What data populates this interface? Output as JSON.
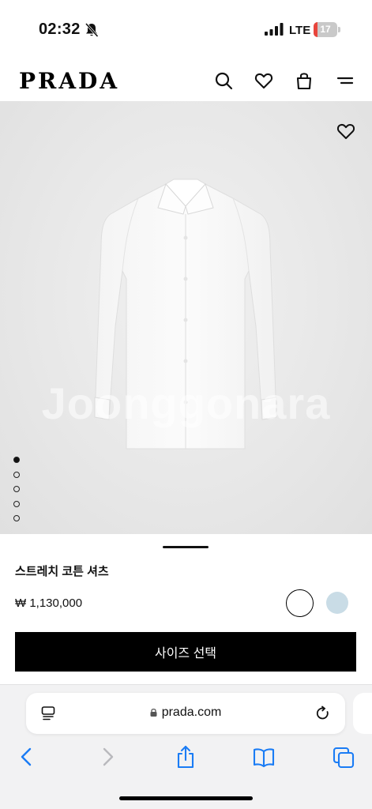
{
  "status_bar": {
    "time": "02:32",
    "network": "LTE",
    "battery_level": "17",
    "battery_fraction": 0.17,
    "icons": [
      "bell-off-icon",
      "signal-icon",
      "battery-icon"
    ]
  },
  "header": {
    "logo": "PRADA",
    "icons": [
      "search-icon",
      "heart-icon",
      "shopping-bag-icon",
      "menu-icon"
    ]
  },
  "product": {
    "watermark": "Joonggonara",
    "image_count": 5,
    "active_image": 1,
    "name": "스트레치 코튼 셔츠",
    "price": "₩ 1,130,000",
    "colors": [
      {
        "name": "white",
        "hex": "#ffffff",
        "selected": true
      },
      {
        "name": "light-blue",
        "hex": "#c9dce6",
        "selected": false
      }
    ],
    "size_button_label": "사이즈 선택"
  },
  "browser": {
    "url": "prada.com",
    "icons": [
      "reader-icon",
      "lock-icon",
      "reload-icon",
      "back-icon",
      "forward-icon",
      "share-icon",
      "bookmarks-icon",
      "tabs-icon"
    ]
  },
  "colors": {
    "accent_black": "#000000",
    "ios_blue": "#1a7cf5",
    "battery_red": "#e8453c"
  }
}
